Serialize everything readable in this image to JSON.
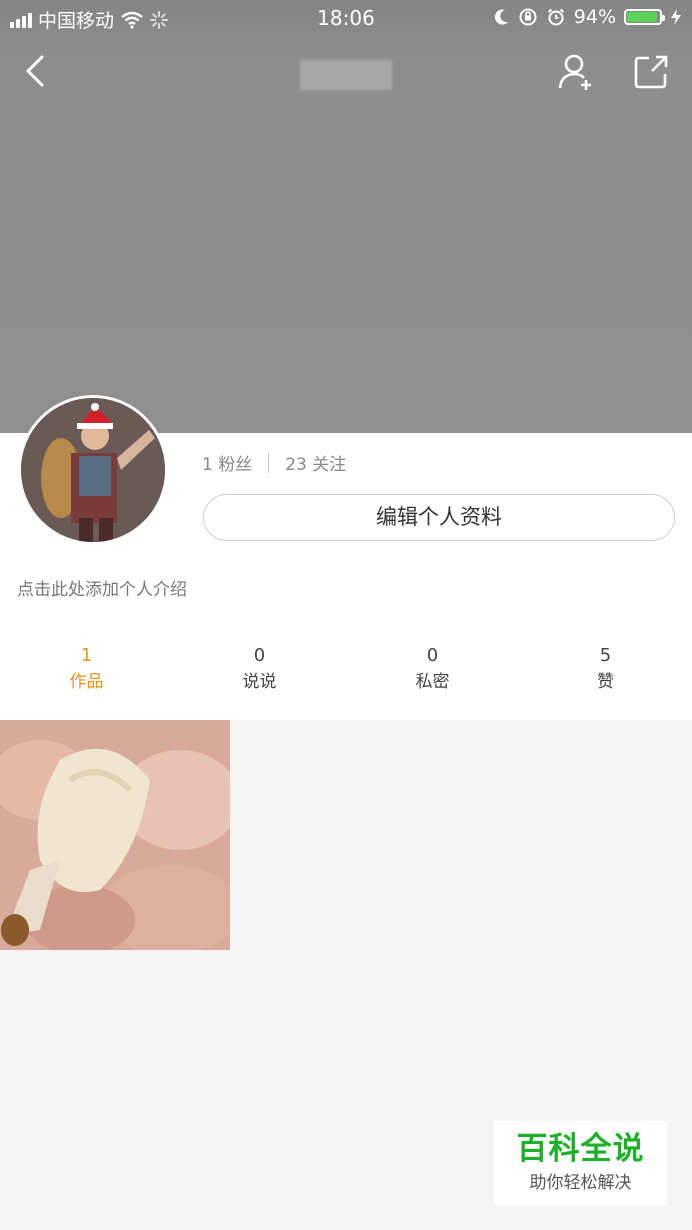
{
  "status_bar": {
    "carrier": "中国移动",
    "time": "18:06",
    "battery_percent": "94%",
    "battery_level": 0.94,
    "battery_color": "#5ad35a",
    "icons": [
      "signal-icon",
      "wifi-icon",
      "loading-icon",
      "moon-icon",
      "orientation-lock-icon",
      "alarm-icon",
      "battery-icon",
      "charging-icon"
    ]
  },
  "nav": {
    "back_icon": "chevron-left-icon",
    "add_user_icon": "add-user-icon",
    "share_icon": "share-icon"
  },
  "profile": {
    "followers": "1 粉丝",
    "following": "23 关注",
    "edit_button": "编辑个人资料",
    "intro_placeholder": "点击此处添加个人介绍"
  },
  "tabs": [
    {
      "count": "1",
      "label": "作品",
      "active": true
    },
    {
      "count": "0",
      "label": "说说",
      "active": false
    },
    {
      "count": "0",
      "label": "私密",
      "active": false
    },
    {
      "count": "5",
      "label": "赞",
      "active": false
    }
  ],
  "accent_color": "#e8931f",
  "watermark": {
    "brand": "百科全说",
    "slogan": "助你轻松解决",
    "brand_color": "#1fb02a"
  }
}
